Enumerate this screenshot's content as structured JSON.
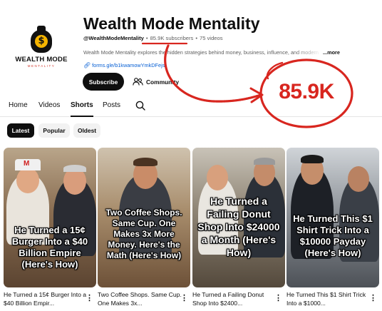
{
  "channel": {
    "logo": {
      "title": "WEALTH MODE",
      "subtitle": "MENTALITY",
      "icon": "money-bag-icon"
    },
    "name": "Wealth Mode Mentality",
    "handle": "@WealthModeMentality",
    "subscribers": "85.9K subscribers",
    "videos": "75 videos",
    "description": "Wealth Mode Mentality explores the hidden strategies behind money, business, influence, and modern",
    "more_label": "...more",
    "link": "forms.gle/b1kwamowYmkDFejs"
  },
  "actions": {
    "subscribe_label": "Subscribe",
    "community_label": "Community"
  },
  "tabs": [
    {
      "label": "Home",
      "active": false
    },
    {
      "label": "Videos",
      "active": false
    },
    {
      "label": "Shorts",
      "active": true
    },
    {
      "label": "Posts",
      "active": false
    }
  ],
  "chips": [
    {
      "label": "Latest",
      "active": true
    },
    {
      "label": "Popular",
      "active": false
    },
    {
      "label": "Oldest",
      "active": false
    }
  ],
  "annotation": {
    "highlight_text": "85.9K",
    "color": "#d8261f"
  },
  "shorts": [
    {
      "overlay": "He Turned a 15¢ Burger Into a $40 Billion Empire (Here's How)",
      "title": "He Turned a 15¢ Burger Into a $40 Billion Empir..."
    },
    {
      "overlay": "Two Coffee Shops. Same Cup. One Makes 3x More Money. Here's the Math (Here's How)",
      "title": "Two Coffee Shops. Same Cup. One Makes 3x..."
    },
    {
      "overlay": "He Turned a Failing Donut Shop Into $24000 a Month (Here's How)",
      "title": "He Turned a Failing Donut Shop Into $2400..."
    },
    {
      "overlay": "He Turned This $1 Shirt Trick Into a $10000 Payday (Here's How)",
      "title": "He Turned This $1 Shirt Trick Into a $1000..."
    }
  ],
  "kebab_symbol": "⋮"
}
